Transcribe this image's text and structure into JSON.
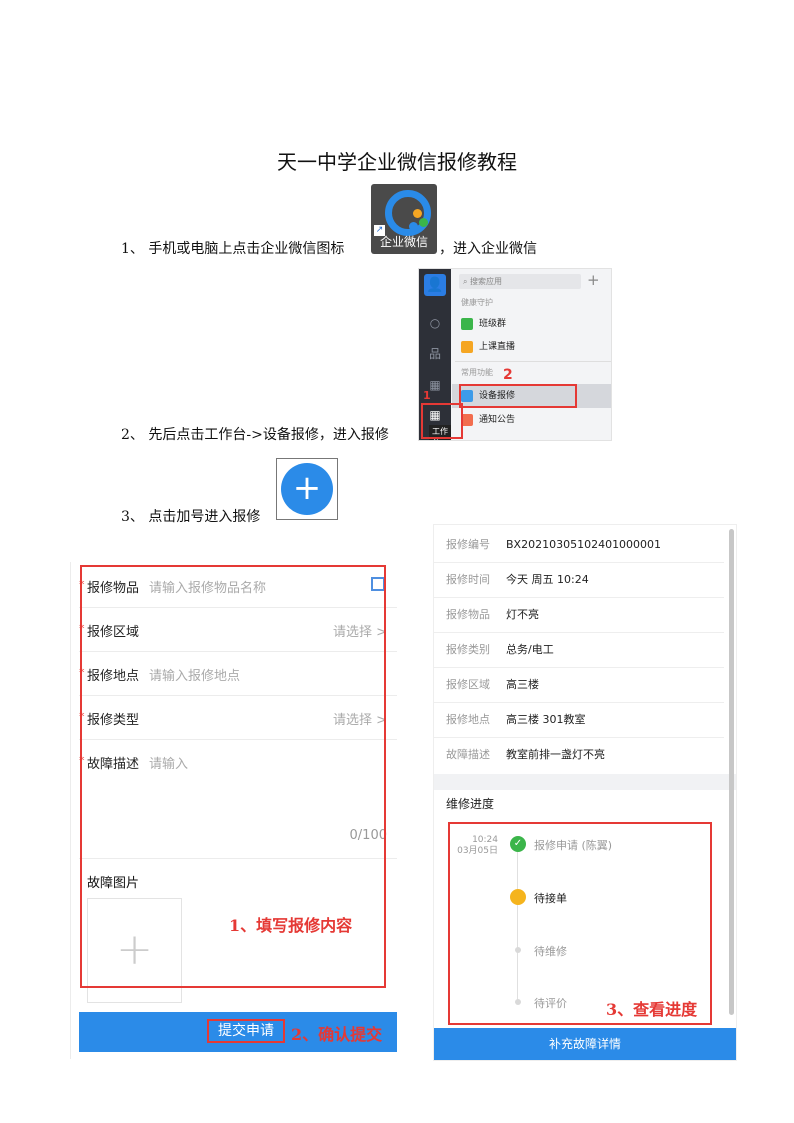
{
  "title": "天一中学企业微信报修教程",
  "steps": {
    "s1_pre": "1、 手机或电脑上点击企业微信图标",
    "s1_post": "，进入企业微信",
    "s2": "2、 先后点击工作台->设备报修，进入报修",
    "s3": "3、 点击加号进入报修"
  },
  "app_icon": {
    "caption": "企业微信",
    "colors": {
      "ring": "#2a8be8",
      "bg": "#4a4a4a"
    }
  },
  "workbench": {
    "search_placeholder": "搜索应用",
    "plus": "+",
    "section1": "健康守护",
    "section2": "常用功能",
    "items": [
      {
        "label": "班级群",
        "color": "#3bb54a"
      },
      {
        "label": "上课直播",
        "color": "#f5a623"
      },
      {
        "label": "设备报修",
        "color": "#3d9be9"
      },
      {
        "label": "通知公告",
        "color": "#f26d4e"
      }
    ],
    "tooltip": "工作台",
    "markers": [
      "1",
      "2"
    ]
  },
  "plus_button": {
    "symbol": "+"
  },
  "form": {
    "rows": [
      {
        "label": "报修物品",
        "placeholder": "请输入报修物品名称",
        "right": ""
      },
      {
        "label": "报修区域",
        "placeholder": "",
        "right": "请选择 >"
      },
      {
        "label": "报修地点",
        "placeholder": "请输入报修地点",
        "right": ""
      },
      {
        "label": "报修类型",
        "placeholder": "",
        "right": "请选择 >"
      },
      {
        "label": "故障描述",
        "placeholder": "请输入",
        "right": ""
      }
    ],
    "required_mark": "*",
    "counter": "0/100",
    "image_label": "故障图片",
    "image_add": "+",
    "submit": "提交申请",
    "annotation1": "1、填写报修内容",
    "annotation2": "2、确认提交"
  },
  "detail": {
    "rows": [
      {
        "k": "报修编号",
        "v": "BX20210305102401000001"
      },
      {
        "k": "报修时间",
        "v": "今天 周五 10:24"
      },
      {
        "k": "报修物品",
        "v": "灯不亮"
      },
      {
        "k": "报修类别",
        "v": "总务/电工"
      },
      {
        "k": "报修区域",
        "v": "高三楼"
      },
      {
        "k": "报修地点",
        "v": "高三楼 301教室"
      },
      {
        "k": "故障描述",
        "v": "教室前排一盏灯不亮"
      }
    ],
    "progress_title": "维修进度",
    "timeline": [
      {
        "time1": "10:24",
        "time2": "03月05日",
        "label": "报修申请 (陈翼)",
        "state": "done",
        "color": "#3bb54a"
      },
      {
        "time1": "",
        "time2": "",
        "label": "待接单",
        "state": "current",
        "color": "#f5b41d"
      },
      {
        "time1": "",
        "time2": "",
        "label": "待维修",
        "state": "pending",
        "color": "#d9d9d9"
      },
      {
        "time1": "",
        "time2": "",
        "label": "待评价",
        "state": "pending",
        "color": "#d9d9d9"
      }
    ],
    "annotation3": "3、查看进度",
    "bottom_button": "补充故障详情"
  }
}
